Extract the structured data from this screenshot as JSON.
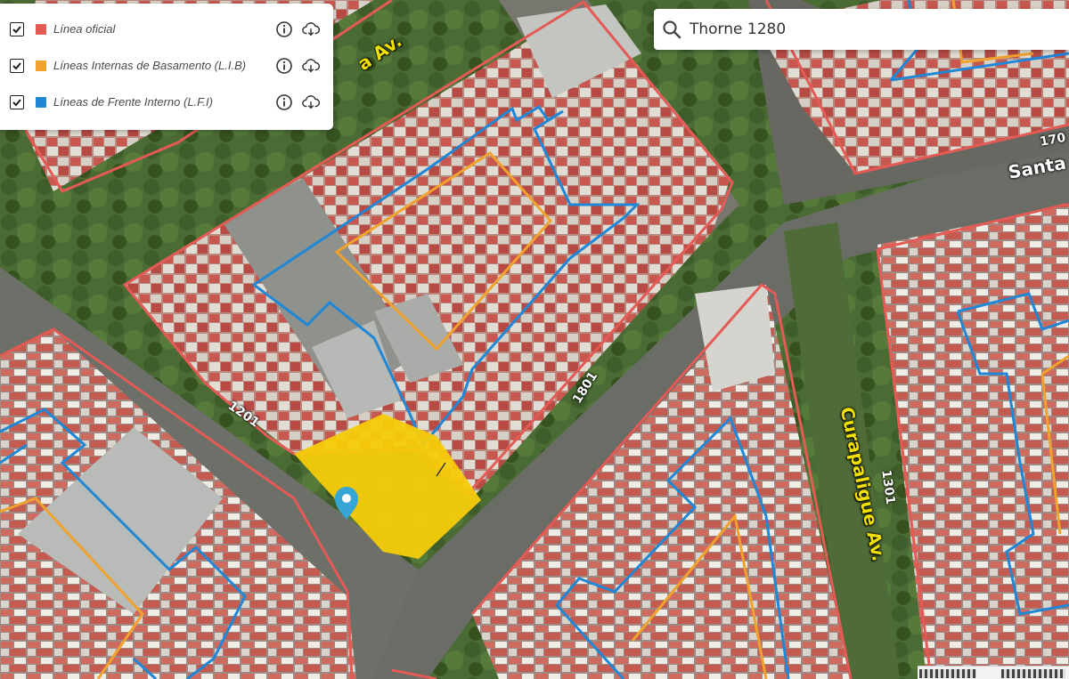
{
  "search": {
    "value": "Thorne 1280",
    "icon": "search-icon"
  },
  "layers": [
    {
      "label": "Línea oficial",
      "color": "#e45a55",
      "checked": true
    },
    {
      "label": "Líneas Internas de Basamento (L.I.B)",
      "color": "#f0a22d",
      "checked": true
    },
    {
      "label": "Líneas de Frente Interno (L.F.I)",
      "color": "#1f87d6",
      "checked": true
    }
  ],
  "map": {
    "streets": {
      "avenida_partial": "a Av.",
      "santa_partial": "Santa",
      "curapaligue": "Curapaligue Av."
    },
    "numbers": {
      "n1201": "1201",
      "n1801": "1801",
      "n1301": "1301",
      "n170": "170"
    },
    "colors": {
      "official_line": "#e45a55",
      "basement_line": "#f0a22d",
      "internal_front_line": "#1f87d6",
      "selected_parcel": "#f6cc0a",
      "marker": "#35a6d6"
    }
  }
}
